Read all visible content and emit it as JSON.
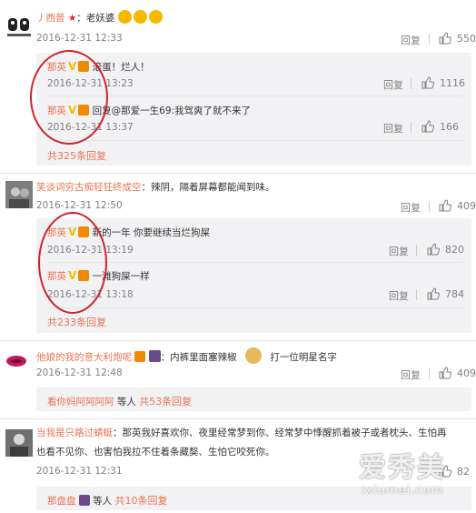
{
  "comments": [
    {
      "user": "丿西普",
      "text": "：老妖婆",
      "time": "2016-12-31 12:33",
      "reply": "回复",
      "likes": "550",
      "replies": [
        {
          "user": "那英",
          "text": "滚蛋！烂人！",
          "time": "2016-12-31 13:23",
          "reply": "回复",
          "likes": "1116"
        },
        {
          "user": "那英",
          "text": "回复@那爱一生69:我驾爽了就不来了",
          "time": "2016-12-31 13:37",
          "reply": "回复",
          "likes": "166"
        }
      ],
      "more": "共325条回复"
    },
    {
      "user": "笑谈词穷古痴轻狂终成空",
      "text": "：辣阴，隔着屏幕都能闻到味。",
      "time": "2016-12-31 12:50",
      "reply": "回复",
      "likes": "409",
      "replies": [
        {
          "user": "那英",
          "text": "新的一年 你要继续当烂狗屎",
          "time": "2016-12-31 13:19",
          "reply": "回复",
          "likes": "820"
        },
        {
          "user": "那英",
          "text": "一滩狗屎一样",
          "time": "2016-12-31 13:18",
          "reply": "回复",
          "likes": "784"
        }
      ],
      "more": "共233条回复"
    },
    {
      "user": "他娘的我的意大利炮呢",
      "text": "：内裤里面塞辣椒",
      "text2": "打一位明星名字",
      "time": "2016-12-31 12:48",
      "reply": "回复",
      "likes": "409",
      "footer_user": "看你妈阿阿阿阿",
      "footer_rest": "等人",
      "footer_more": "共53条回复"
    },
    {
      "user": "当我是只路过蜻蜓",
      "text": "：那英我好喜欢你、夜里经常梦到你、经常梦中悸醒抓着被子或者枕头、生怕再",
      "text_line2": "也看不见你、也害怕我拉不住着条藏獒、生怕它咬死你。",
      "time": "2016-12-31 12:31",
      "likes": "82",
      "footer_user": "那盘盘",
      "footer_rest": "等人",
      "footer_more": "共10条回复"
    }
  ],
  "watermark": {
    "cn": "爱秀美",
    "en": "ixiumei.com"
  }
}
